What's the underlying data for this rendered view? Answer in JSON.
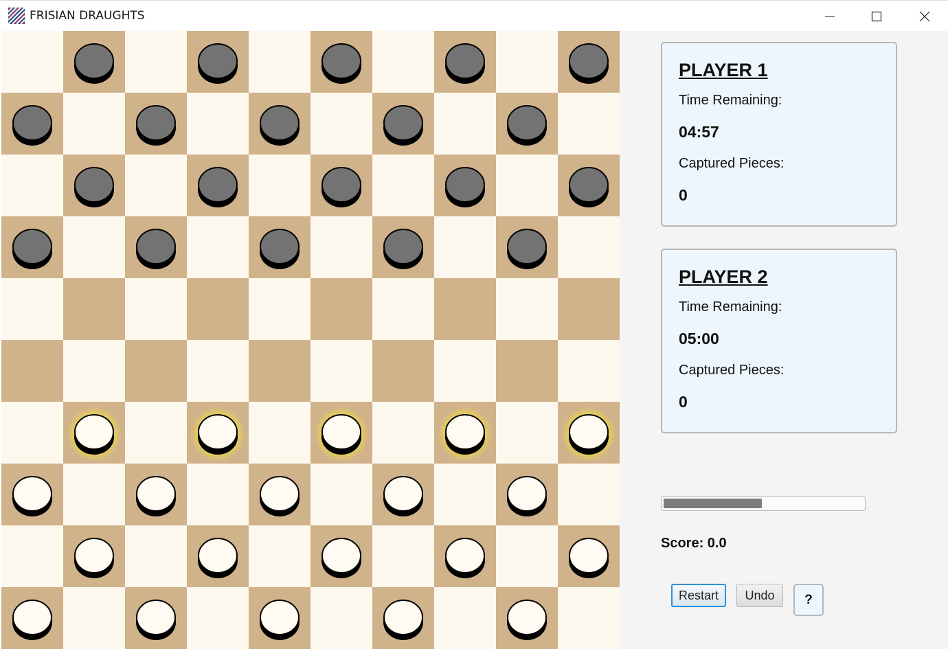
{
  "window": {
    "title": "FRISIAN DRAUGHTS"
  },
  "board": {
    "size": 10,
    "light_color": "#fdf8ee",
    "dark_color": "#d0b28b",
    "piece_colors": {
      "dark": "#737373",
      "light": "#fffaf2",
      "highlight": "#f2e23a"
    },
    "pieces": [
      "-d-d-d-d-d",
      "d-d-d-d-d-",
      "-d-d-d-d-d",
      "d-d-d-d-d-",
      "----------",
      "----------",
      "-L-L-L-L-L",
      "l-l-l-l-l-",
      "-l-l-l-l-l",
      "l-l-l-l-l-"
    ]
  },
  "player1": {
    "title": "PLAYER 1",
    "time_label": "Time Remaining:",
    "time": "04:57",
    "captured_label": "Captured Pieces:",
    "captured": "0"
  },
  "player2": {
    "title": "PLAYER 2",
    "time_label": "Time Remaining:",
    "time": "05:00",
    "captured_label": "Captured Pieces:",
    "captured": "0"
  },
  "progress": {
    "fraction": 0.49
  },
  "score": {
    "text": "Score: 0.0"
  },
  "buttons": {
    "restart": "Restart",
    "undo": "Undo",
    "help": "?"
  }
}
